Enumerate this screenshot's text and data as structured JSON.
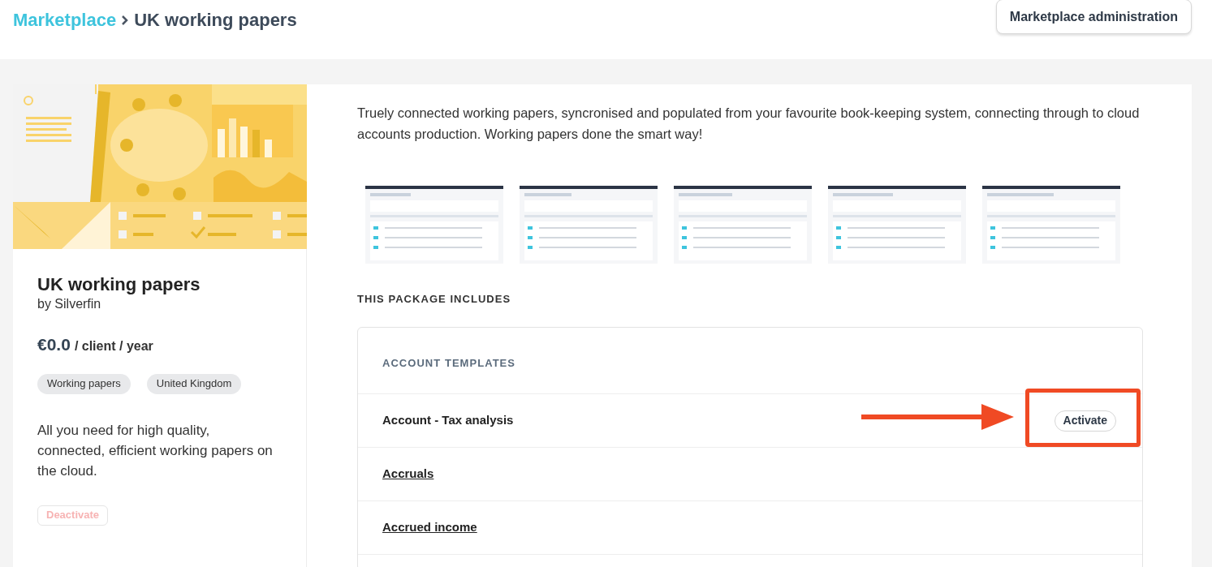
{
  "breadcrumb": [
    {
      "label": "Marketplace",
      "link": true
    },
    {
      "label": "UK working papers",
      "link": false
    }
  ],
  "header_button": "Marketplace administration",
  "package": {
    "title": "UK working papers",
    "author": "by Silverfin",
    "price": "€0.0",
    "price_unit": "/ client / year",
    "tags": [
      "Working papers",
      "United Kingdom"
    ],
    "summary": "All you need for high quality, connected, efficient working papers on the cloud.",
    "button": {
      "label": "Deactivate",
      "disabled": true
    }
  },
  "description": "Truely connected working papers, syncronised and populated from your favourite book-keeping system, connecting through to cloud accounts production. Working papers done the smart way!",
  "includes_heading": "THIS PACKAGE INCLUDES",
  "section": {
    "heading": "ACCOUNT TEMPLATES",
    "items": [
      {
        "name": "Account - Tax analysis",
        "link": false,
        "action": "Activate",
        "highlighted": true
      },
      {
        "name": "Accruals",
        "link": true,
        "highlighted": false
      },
      {
        "name": "Accrued income",
        "link": true,
        "highlighted": false
      }
    ]
  }
}
